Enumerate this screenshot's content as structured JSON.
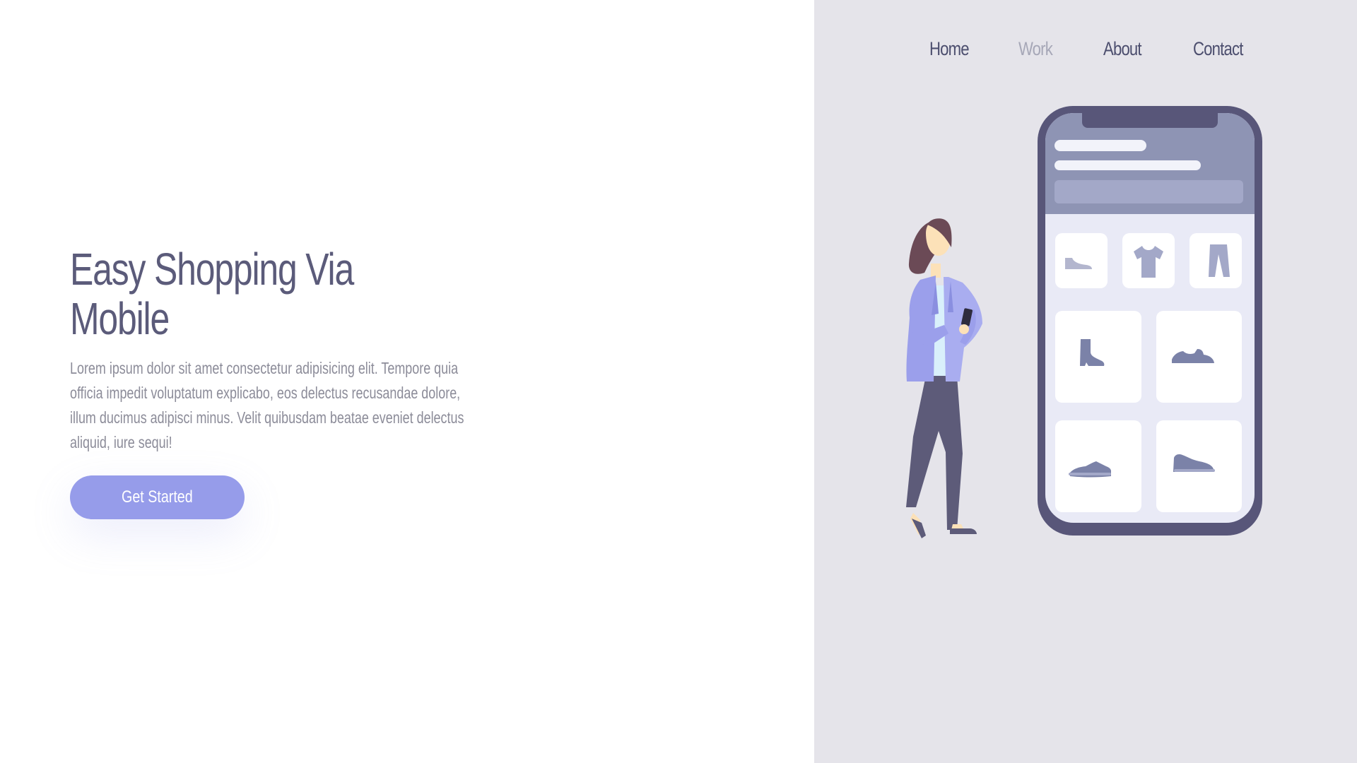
{
  "nav": {
    "items": [
      {
        "label": "Home",
        "active": false
      },
      {
        "label": "Work",
        "active": true
      },
      {
        "label": "About",
        "active": false
      },
      {
        "label": "Contact",
        "active": false
      }
    ]
  },
  "hero": {
    "title_line1": "Easy Shopping Via",
    "title_line2": "Mobile",
    "description": "Lorem ipsum dolor sit amet consectetur adipisicing elit. Tempore quia officia impedit voluptatum explicabo, eos delectus recusandae dolore, illum ducimus adipisci minus. Velit quibusdam beatae eveniet delectus aliquid, iure sequi!",
    "cta_label": "Get Started"
  },
  "colors": {
    "accent": "#969cea",
    "heading": "#5b5b7a",
    "body_text": "#8c8c99",
    "panel_bg": "#e5e4ea",
    "phone_frame": "#585679",
    "nav_active": "#a6a7b7"
  },
  "illustration": {
    "product_icons": [
      "shoe-icon",
      "tshirt-icon",
      "pants-icon",
      "boot-icon",
      "sneaker-icon",
      "sneaker-icon",
      "sneaker-icon"
    ]
  }
}
